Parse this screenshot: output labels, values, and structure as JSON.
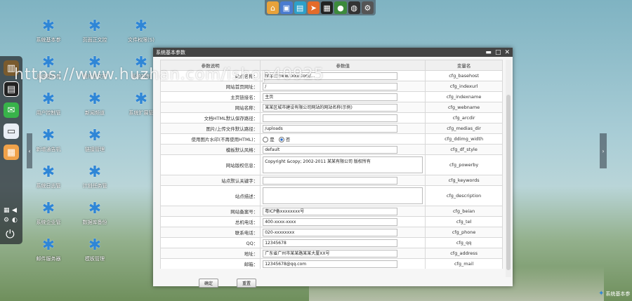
{
  "watermark": "https://www.huzhan.com/ishop40925",
  "top_dock": [
    "home-icon",
    "computer-icon",
    "folder-icon",
    "send-icon",
    "message-icon",
    "user-icon",
    "globe-icon",
    "settings-icon"
  ],
  "left_dock": {
    "items": [
      "books-icon",
      "notes-icon",
      "chat-icon",
      "drive-icon",
      "document-icon"
    ],
    "controls": [
      "grid-icon",
      "volume-icon",
      "gear-icon",
      "palette-icon",
      "power-icon"
    ]
  },
  "desktop_icons": [
    "系统基本参",
    "页面正文控",
    "文件权限(S)",
    "系统基本参",
    "图片正文控",
    "系统控制",
    "用户控制管",
    "新闻频道",
    "系统扩展管",
    "新增通告机",
    "链接管理",
    "",
    "系统日志管",
    "计划任务管",
    "",
    "系统企业管",
    "数据库备份",
    "",
    "邮件服务器",
    "模板管理"
  ],
  "window": {
    "title": "系统基本参数",
    "controls": {
      "minimize": "▬",
      "maximize": "□",
      "close": "✕"
    },
    "table": {
      "headers": {
        "desc": "参数说明",
        "value": "参数值",
        "var": "变量名"
      },
      "rows": [
        {
          "desc": "站点名称：",
          "type": "input",
          "value": "http://www.xxxx.com/...",
          "var": "cfg_basehost"
        },
        {
          "desc": "网站首页网址：",
          "type": "input",
          "value": "/",
          "var": "cfg_indexurl"
        },
        {
          "desc": "主页链接名：",
          "type": "input",
          "value": "主页",
          "var": "cfg_indexname"
        },
        {
          "desc": "网站名称：",
          "type": "input",
          "value": "某某区城市建设有限公司网站的网站名称(示例)",
          "var": "cfg_webname"
        },
        {
          "desc": "文档HTML默认保存路径：",
          "type": "input",
          "value": "",
          "var": "cfg_arcdir"
        },
        {
          "desc": "图片/上传文件默认路径：",
          "type": "input",
          "value": "/uploads",
          "var": "cfg_medias_dir"
        },
        {
          "desc": "使用图片水印(不再使用HTML)：",
          "type": "radio",
          "options": [
            "是",
            "否"
          ],
          "selected": 1,
          "var": "cfg_ddimg_width"
        },
        {
          "desc": "模板默认风格：",
          "type": "input",
          "value": "default",
          "var": "cfg_df_style"
        },
        {
          "desc": "网站版权信息：",
          "type": "textarea",
          "value": "Copyright &copy; 2002-2011 某某有限公司 版权所有",
          "var": "cfg_powerby"
        },
        {
          "desc": "站点默认关键字：",
          "type": "input",
          "value": "",
          "var": "cfg_keywords"
        },
        {
          "desc": "站点描述：",
          "type": "textarea",
          "value": "",
          "var": "cfg_description"
        },
        {
          "desc": "网站备案号：",
          "type": "input",
          "value": "粤ICP备xxxxxxxx号",
          "var": "cfg_beian"
        },
        {
          "desc": "总机电话：",
          "type": "input",
          "value": "400-xxxx-xxxx",
          "var": "cfg_tel"
        },
        {
          "desc": "联系电话：",
          "type": "input",
          "value": "020-xxxxxxxx",
          "var": "cfg_phone"
        },
        {
          "desc": "QQ：",
          "type": "input",
          "value": "12345678",
          "var": "cfg_qq"
        },
        {
          "desc": "地址：",
          "type": "input",
          "value": "广东省广州市某某路某某大厦XX号",
          "var": "cfg_address"
        },
        {
          "desc": "邮箱：",
          "type": "input",
          "value": "12345678@qq.com",
          "var": "cfg_mail"
        }
      ]
    },
    "buttons": {
      "confirm": "确定",
      "reset": "重置"
    }
  },
  "bottom_logo": "系统基本参"
}
